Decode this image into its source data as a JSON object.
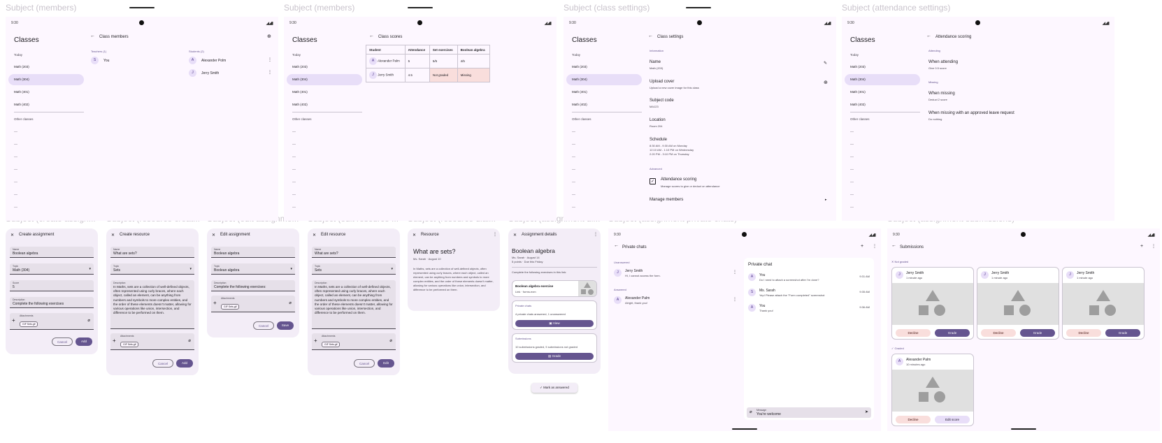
{
  "titles": [
    "Subject (members)",
    "Subject (members)",
    "Subject (class settings)",
    "Subject (attendance settings)",
    "Subject (create assign...",
    "Subject (resource creat...",
    "Subject (edit assignme...",
    "Subject (edit resource ...",
    "Subject (resource dial...",
    "Subject (assignment di...",
    "Subject (assignment private chats)",
    "Subject (assignment submissions)"
  ],
  "status": {
    "time": "9:30",
    "icons": "◢◢▮"
  },
  "nav": {
    "title": "Classes",
    "today": "Today",
    "items": [
      "Math (203)",
      "Math (304)",
      "Math (401)",
      "Math (402)"
    ],
    "other": "Other classes",
    "dash": "—"
  },
  "members": {
    "title": "Class members",
    "teachers": "Teachers (1)",
    "students": "Students (2)",
    "teacher": {
      "initial": "S",
      "name": "You"
    },
    "studentList": [
      {
        "initial": "A",
        "name": "Alexander Polm"
      },
      {
        "initial": "J",
        "name": "Jerry Smith"
      }
    ]
  },
  "scores": {
    "title": "Class scores",
    "headers": [
      "Student",
      "Attendance",
      "Set exercises",
      "Boolean algebra"
    ],
    "rows": [
      {
        "initial": "A",
        "name": "Alexander Palm",
        "att": "5",
        "set": "5/5",
        "bool": "4/5"
      },
      {
        "initial": "J",
        "name": "Jerry Smith",
        "att": "4.5",
        "set": "Not graded",
        "bool": "Missing"
      }
    ]
  },
  "settings": {
    "title": "Class settings",
    "info": "Information",
    "name_l": "Name",
    "name_v": "Math (203)",
    "cover_l": "Upload cover",
    "cover_v": "Upload a new cover image for this class",
    "code_l": "Subject code",
    "code_v": "MA123",
    "loc_l": "Location",
    "loc_v": "Room 204",
    "sched_l": "Schedule",
    "sched_v": [
      "8:30 AM - 9:30 AM on Monday",
      "12:10 AM - 1:10 PM on Wednesday",
      "2:20 PM - 3:10 PM on Thursday"
    ],
    "adv": "Advanced",
    "att_l": "Attendance scoring",
    "att_v": "Manage scores to give or deduct on attendance",
    "manage": "Manage members"
  },
  "attendance": {
    "title": "Attendance scoring",
    "attending": "Attending",
    "when_att": "When attending",
    "when_att_v": "Give 0.5 score",
    "missing": "Missing",
    "when_miss": "When missing",
    "when_miss_v": "Deduct 2 score",
    "when_leave": "When missing with an approved leave request",
    "when_leave_v": "Do nothing"
  },
  "create_assign": {
    "title": "Create assignment",
    "name_l": "Name",
    "name_v": "Boolean algebra",
    "topic_l": "Topic",
    "topic_v": "Math (304)",
    "score_l": "Score",
    "score_v": "5",
    "desc_l": "Description",
    "desc_v": "Complete the following exercises",
    "att_l": "Attachments",
    "chip": "GIF  Sets.gif",
    "cancel": "Cancel",
    "add": "Add"
  },
  "create_res": {
    "title": "Create resource",
    "name_l": "Name",
    "name_v": "What are sets?",
    "topic_l": "Topic",
    "topic_v": "Sets",
    "desc_l": "Description",
    "desc_v": "In Maths, sets are a collection of well-defined objects, often represented using curly braces, where each object, called an element, can be anything from numbers and symbols to more complex entities, and the order of these elements doesn't matter, allowing for various operations like union, intersection, and difference to be performed on them.",
    "att_l": "Attachments",
    "chip": "GIF  Sets.gif",
    "cancel": "Cancel",
    "add": "Add"
  },
  "edit_assign": {
    "title": "Edit assignment",
    "name_l": "Name",
    "name_v": "Boolean algebra",
    "topic_l": "Topic",
    "topic_v": "Boolean algebra",
    "desc_l": "Description",
    "desc_v": "Complete the following exercises:",
    "att_l": "Attachments",
    "chip": "GIF  Sets.gif",
    "cancel": "Cancel",
    "save": "Save"
  },
  "edit_res": {
    "title": "Edit resource",
    "name_l": "Name",
    "name_v": "What are sets?",
    "topic_l": "Topic",
    "topic_v": "Sets",
    "desc_l": "Description",
    "desc_v": "In Maths, sets are a collection of well-defined objects, often represented using curly braces, where each object, called an element, can be anything from numbers and symbols to more complex entities, and the order of these elements doesn't matter, allowing for various operations like union, intersection, and difference to be performed on them.",
    "att_l": "Attachments",
    "chip": "GIF  Sets.gif",
    "cancel": "Cancel",
    "edit": "Edit"
  },
  "resource": {
    "title": "Resource",
    "heading": "What are sets?",
    "meta": "Ms. Sarah · August 10",
    "body": "In Maths, sets are a collection of well-defined objects, often represented using curly braces, where each object, called an element, can be anything from numbers and symbols to more complex entities, and the order of these elements doesn't matter, allowing for various operations like union, intersection, and difference to be performed on them."
  },
  "assign_details": {
    "title": "Assignment details",
    "heading": "Boolean algebra",
    "meta1": "Ms. Sarah · August 14",
    "meta2": "5 points · Due this Friday",
    "desc": "Complete the following exercises in this link:",
    "link_t": "Boolean algebra exercise",
    "link_v": "Link · forms.exm",
    "chats": "Private chats",
    "chats_v": "4 private chats answered, 1 unanswered",
    "view": "View",
    "subs": "Submissions",
    "subs_v": "10 submissions graded, 5 submissions not graded",
    "grade": "Grade",
    "mark": "Mark as answered"
  },
  "private": {
    "title": "Private chats",
    "unanswered": "Unanswered",
    "answered": "Answered",
    "list": [
      {
        "initial": "J",
        "name": "Jerry Smith",
        "msg": "Hi, I cannot access the form."
      },
      {
        "initial": "A",
        "name": "Alexander Palm",
        "msg": "Alright, thank you!"
      }
    ],
    "chat_title": "Private chat",
    "messages": [
      {
        "initial": "A",
        "name": "You",
        "msg": "Do I need to attach a screenshot after I'm done?",
        "time": "9:31 AM"
      },
      {
        "initial": "S",
        "name": "Ms. Sarah",
        "msg": "Yep! Please attach the \"Form completed\" screenshot",
        "time": "9:35 AM"
      },
      {
        "initial": "A",
        "name": "You",
        "msg": "Thank you!",
        "time": "9:36 AM"
      }
    ],
    "input_l": "Message",
    "input_v": "You're welcome"
  },
  "submissions": {
    "title": "Submissions",
    "not_graded": "Not graded",
    "graded": "Graded",
    "cards": [
      {
        "initial": "J",
        "name": "Jerry Smith",
        "time": "1 minute ago",
        "b1": "Decline",
        "b2": "Grade"
      },
      {
        "initial": "J",
        "name": "Jerry Smith",
        "time": "1 minute ago",
        "b1": "Decline",
        "b2": "Grade"
      },
      {
        "initial": "J",
        "name": "Jerry Smith",
        "time": "1 minute ago",
        "b1": "Decline",
        "b2": "Grade"
      }
    ],
    "graded_card": {
      "initial": "A",
      "name": "Alexander Palm",
      "time": "10 minutes ago",
      "b1": "Decline",
      "b2": "Edit score"
    }
  }
}
